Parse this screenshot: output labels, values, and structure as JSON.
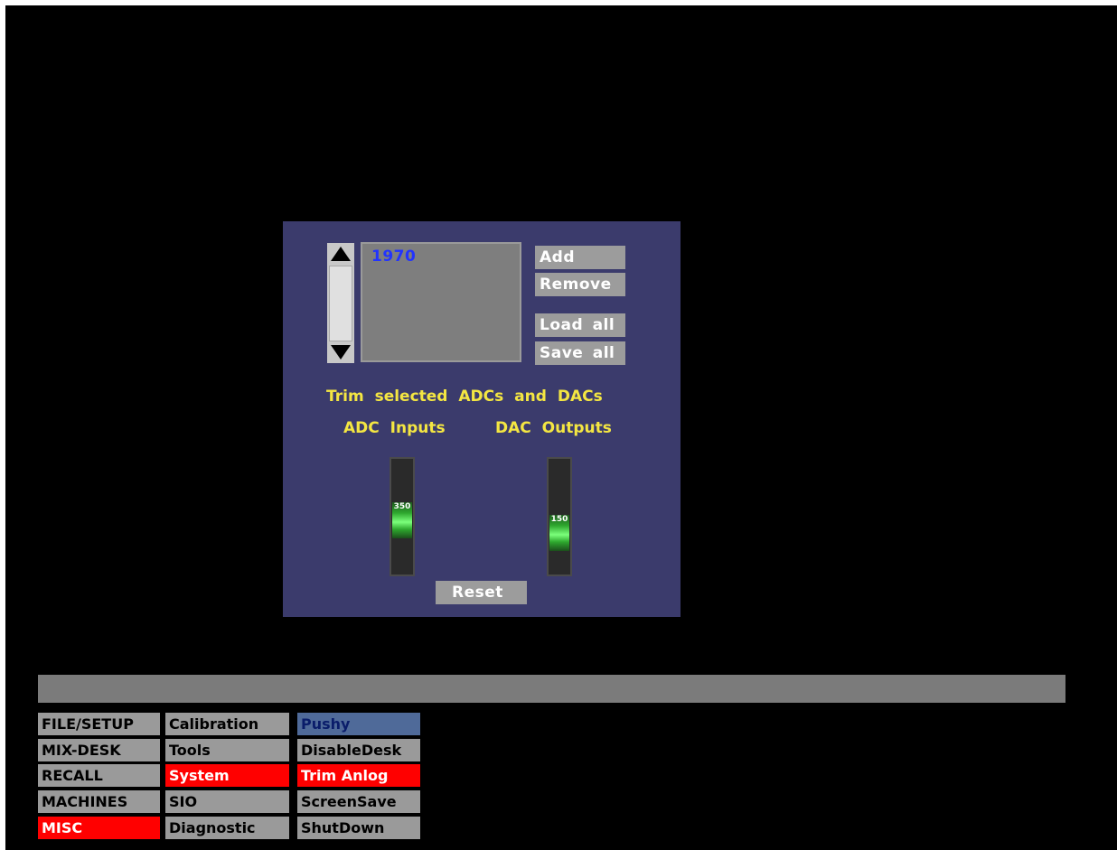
{
  "dialog": {
    "list_items": [
      "1970"
    ],
    "buttons": {
      "add": "Add",
      "remove": "Remove",
      "load_all": "Load all",
      "save_all": "Save all",
      "reset": "Reset"
    },
    "heading": "Trim selected ADCs and DACs",
    "adc_label": "ADC Inputs",
    "dac_label": "DAC Outputs",
    "adc_fader": {
      "value": "350",
      "level": 0.45
    },
    "dac_fader": {
      "value": "150",
      "level": 0.3
    }
  },
  "status_bar": {
    "text": ""
  },
  "menu": {
    "col1": [
      "FILE/SETUP",
      "MIX-DESK",
      "RECALL",
      "MACHINES",
      "MISC"
    ],
    "col2": [
      "Calibration",
      "Tools",
      "System",
      "SIO",
      "Diagnostic"
    ],
    "col3": [
      "Pushy",
      "DisableDesk",
      "Trim Anlog",
      "ScreenSave",
      "ShutDown"
    ],
    "active": {
      "col1": "MISC",
      "col2": "System",
      "col3": "Trim Anlog"
    },
    "highlight": "Pushy"
  },
  "colors": {
    "panel": "#3b3b6c",
    "active": "#ff0000",
    "highlight": "#4f6a99",
    "label_text": "#f4e642",
    "list_text": "#2233ff"
  },
  "icons": [
    "arrow-up-icon",
    "arrow-down-icon"
  ]
}
